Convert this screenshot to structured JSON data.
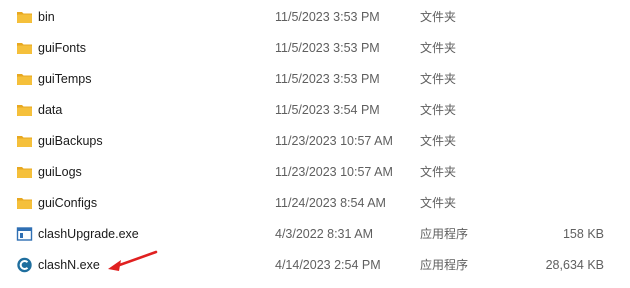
{
  "file_list": {
    "rows": [
      {
        "name": "bin",
        "date": "11/5/2023 3:53 PM",
        "type": "文件夹",
        "size": "",
        "icon": "folder-icon"
      },
      {
        "name": "guiFonts",
        "date": "11/5/2023 3:53 PM",
        "type": "文件夹",
        "size": "",
        "icon": "folder-icon"
      },
      {
        "name": "guiTemps",
        "date": "11/5/2023 3:53 PM",
        "type": "文件夹",
        "size": "",
        "icon": "folder-icon"
      },
      {
        "name": "data",
        "date": "11/5/2023 3:54 PM",
        "type": "文件夹",
        "size": "",
        "icon": "folder-icon"
      },
      {
        "name": "guiBackups",
        "date": "11/23/2023 10:57 AM",
        "type": "文件夹",
        "size": "",
        "icon": "folder-icon"
      },
      {
        "name": "guiLogs",
        "date": "11/23/2023 10:57 AM",
        "type": "文件夹",
        "size": "",
        "icon": "folder-icon"
      },
      {
        "name": "guiConfigs",
        "date": "11/24/2023 8:54 AM",
        "type": "文件夹",
        "size": "",
        "icon": "folder-icon"
      },
      {
        "name": "clashUpgrade.exe",
        "date": "4/3/2022 8:31 AM",
        "type": "应用程序",
        "size": "158 KB",
        "icon": "application-window-icon"
      },
      {
        "name": "clashN.exe",
        "date": "4/14/2023 2:54 PM",
        "type": "应用程序",
        "size": "28,634 KB",
        "icon": "clashn-app-icon"
      }
    ]
  },
  "colors": {
    "folder_body": "#f5c03b",
    "folder_back": "#e8a820",
    "app_icon_blue": "#2f6fb3",
    "clashn_icon": "#1f6e9e",
    "arrow_red": "#e02020"
  }
}
